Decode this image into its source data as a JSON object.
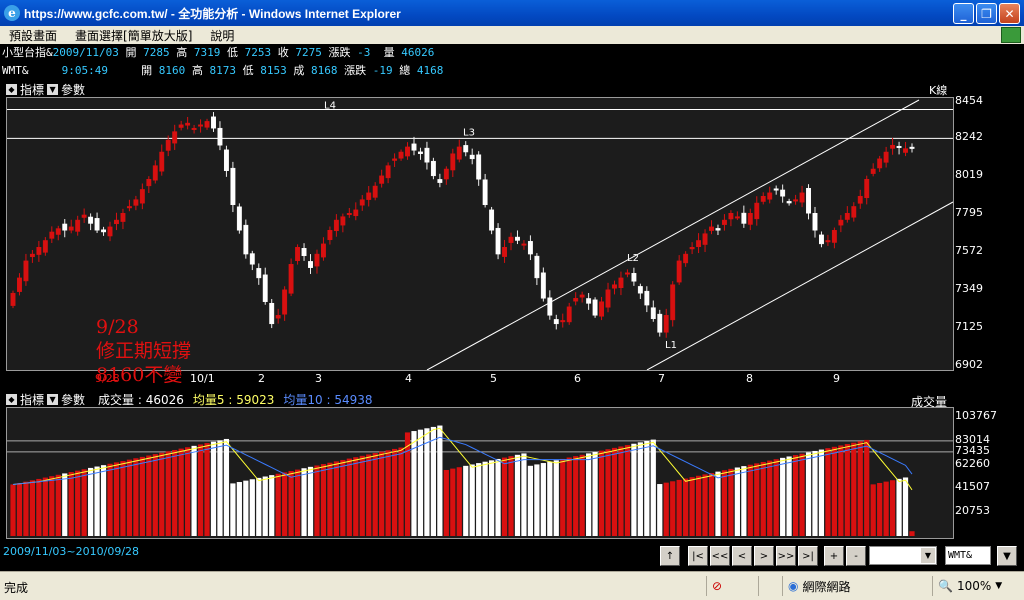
{
  "window": {
    "title": "https://www.gcfc.com.tw/ - 全功能分析 - Windows Internet Explorer"
  },
  "menu": [
    "預設畫面",
    "畫面選擇[簡單放大版]",
    "說明"
  ],
  "info_rows": [
    {
      "name": "小型台指&",
      "date": "2009/11/03",
      "open_label": "開",
      "open": "7285",
      "high_label": "高",
      "high": "7319",
      "low_label": "低",
      "low": "7253",
      "close_label": "收",
      "close": "7275",
      "chg_label": "漲跌",
      "chg": "-3",
      "vol_label": "量",
      "vol": "46026"
    },
    {
      "name": "WMT&",
      "date": "9:05:49",
      "open_label": "開",
      "open": "8160",
      "high_label": "高",
      "high": "8173",
      "low_label": "低",
      "low": "8153",
      "close_label": "成",
      "close": "8168",
      "chg_label": "漲跌",
      "chg": "-19",
      "vol_label": "總",
      "vol": "4168"
    }
  ],
  "price_panel": {
    "indicator_label": "指標",
    "param_label": "參數",
    "type_label": "K線",
    "y_ticks": [
      "8454",
      "8242",
      "8019",
      "7795",
      "7572",
      "7349",
      "7125",
      "6902"
    ],
    "x_labels": [
      "9/28",
      "10/1",
      "2",
      "3",
      "4",
      "5",
      "6",
      "7",
      "8",
      "9"
    ],
    "annotations": [
      "L4",
      "L3",
      "L2",
      "L1"
    ],
    "note_lines": [
      "9/28",
      "修正期短撐",
      "8160不變"
    ]
  },
  "volume_panel": {
    "indicator_label": "指標",
    "param_label": "參數",
    "vol_text": "成交量 : 46026",
    "ma5_text": "均量5 : 59023",
    "ma10_text": "均量10 : 54938",
    "type_label": "成交量",
    "y_ticks": [
      "103767",
      "83014",
      "73435",
      "62260",
      "41507",
      "20753"
    ]
  },
  "chart_data": [
    {
      "type": "candlestick",
      "title": "",
      "y_ticks": [
        8454,
        8242,
        8019,
        7795,
        7572,
        7349,
        7125,
        6902
      ],
      "ylim": [
        6902,
        8454
      ],
      "horizontal_lines": [
        {
          "label": "L4",
          "y": 8410
        },
        {
          "label": "L3",
          "y": 8240
        }
      ],
      "note": "9/28 修正期短撐 8160不變",
      "x_labels": [
        "9/28",
        "10/1",
        "2",
        "3",
        "4",
        "5",
        "6",
        "7",
        "8",
        "9"
      ]
    },
    {
      "type": "bar",
      "series": [
        {
          "name": "成交量",
          "last": 46026
        },
        {
          "name": "均量5",
          "last": 59023
        },
        {
          "name": "均量10",
          "last": 54938
        }
      ],
      "y_ticks": [
        103767,
        83014,
        73435,
        62260,
        41507,
        20753
      ]
    }
  ],
  "bottom": {
    "range": "2009/11/03~2010/09/28",
    "nav_buttons": [
      "↑",
      "|<",
      "<<",
      "<",
      ">",
      ">>",
      ">|",
      "+",
      "-"
    ],
    "symbol": "WMT&"
  },
  "status": {
    "text": "完成",
    "zone": "網際網路",
    "zoom": "100%"
  },
  "colors": {
    "up": "#d81010",
    "down": "#ffffff",
    "ma5": "#ffff33",
    "ma10": "#3a7bff",
    "accent": "#36c9ff"
  }
}
